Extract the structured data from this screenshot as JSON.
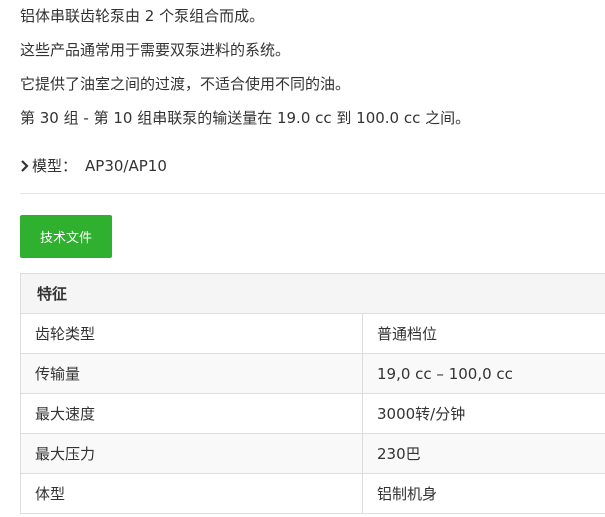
{
  "description": {
    "line1": "铝体串联齿轮泵由 2 个泵组合而成。",
    "line2": "这些产品通常用于需要双泵进料的系统。",
    "line3": "它提供了油室之间的过渡，不适合使用不同的油。",
    "line4": "第 30 组 - 第 10 组串联泵的输送量在 19.0 cc 到 100.0 cc 之间。"
  },
  "model": {
    "label": "模型：",
    "value": "AP30/AP10"
  },
  "tech_button": {
    "label": "技术文件"
  },
  "colors": {
    "accent_green": "#2fb02f",
    "header_bg": "#f5f5f5",
    "border": "#dddddd"
  },
  "features_table": {
    "header": "特征",
    "rows": [
      {
        "key": "齿轮类型",
        "value": "普通档位"
      },
      {
        "key": "传输量",
        "value": "19,0 cc – 100,0 cc"
      },
      {
        "key": "最大速度",
        "value": "3000转/分钟"
      },
      {
        "key": "最大压力",
        "value": "230巴"
      },
      {
        "key": "体型",
        "value": "铝制机身"
      }
    ]
  }
}
